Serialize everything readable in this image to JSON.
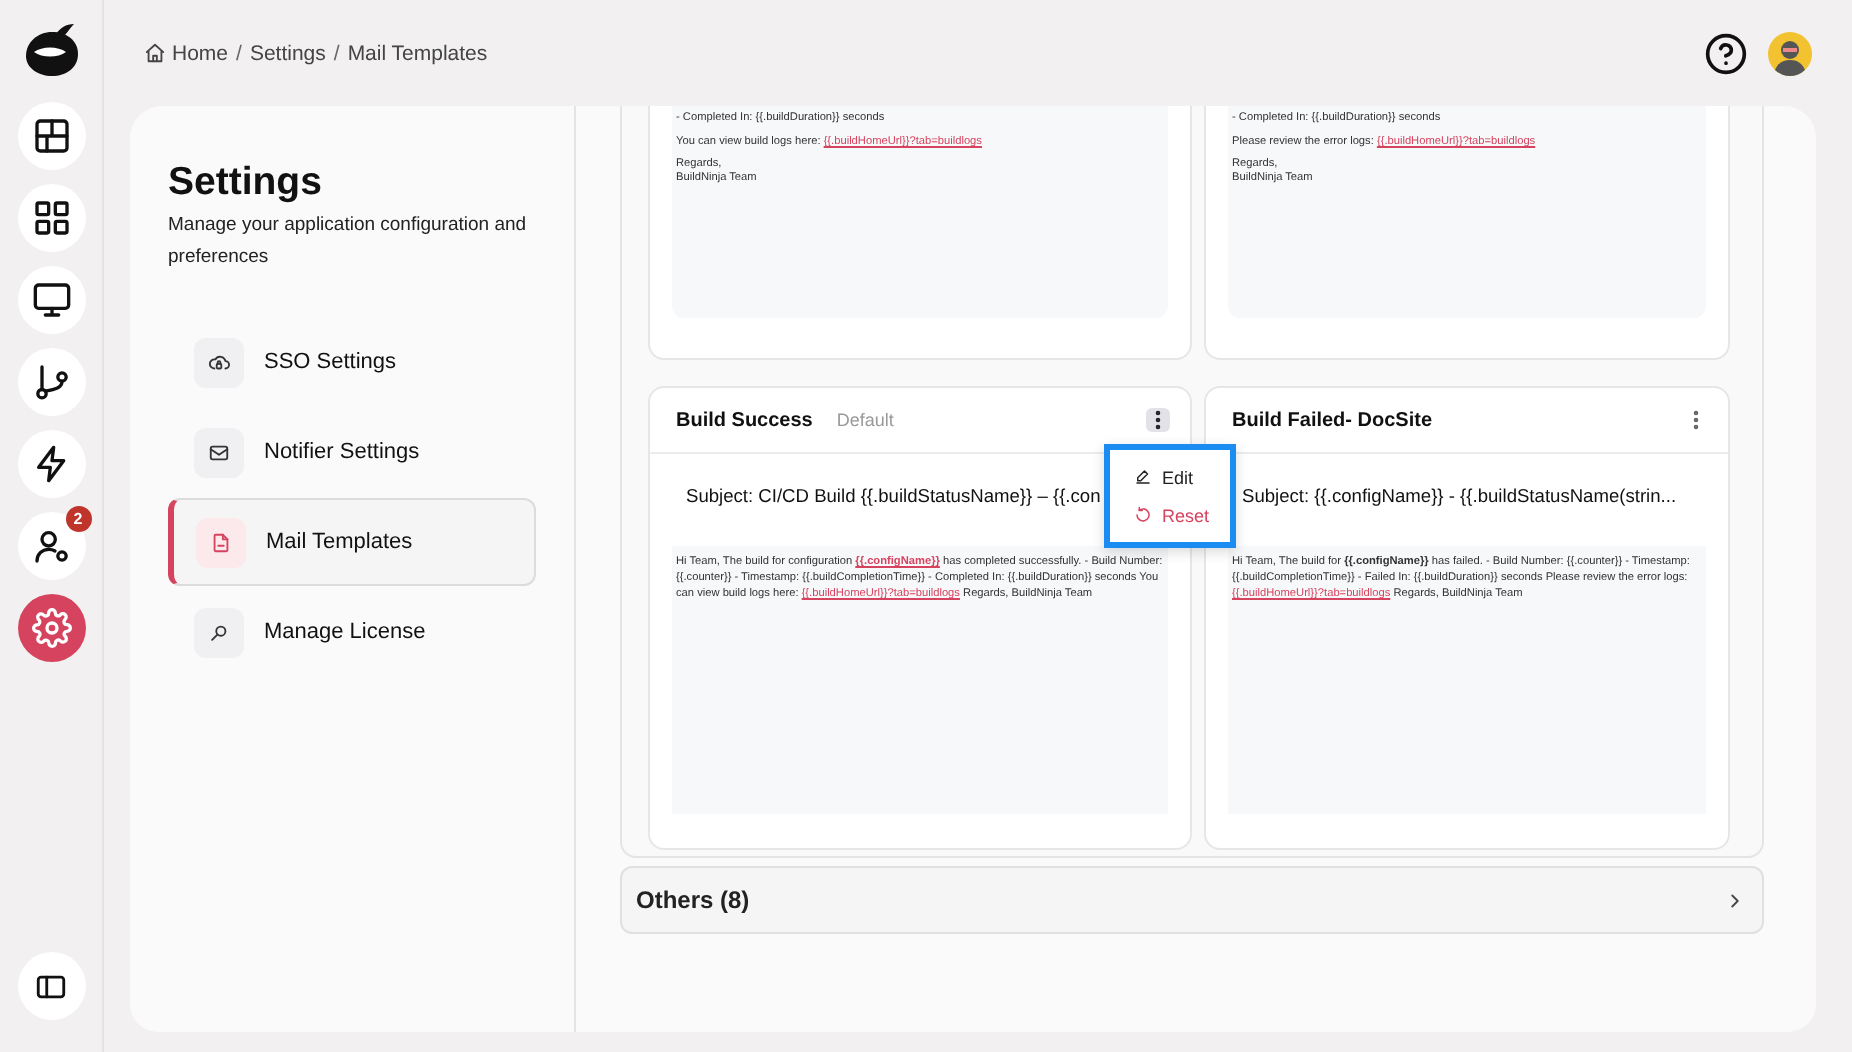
{
  "rail": {
    "items": [
      {
        "kind": "layout",
        "selected": false
      },
      {
        "kind": "grid",
        "selected": false
      },
      {
        "kind": "monitor",
        "selected": false
      },
      {
        "kind": "branch",
        "selected": false
      },
      {
        "kind": "bolt",
        "selected": false
      },
      {
        "kind": "user-gear",
        "selected": false,
        "badge": "2"
      },
      {
        "kind": "gear",
        "selected": true
      }
    ],
    "footer": {
      "kind": "panel"
    }
  },
  "breadcrumb": [
    "Home",
    "Settings",
    "Mail Templates"
  ],
  "breadcrumb_separator": "/",
  "settings": {
    "title": "Settings",
    "description": "Manage your application configuration and preferences",
    "items": [
      {
        "label": "SSO Settings",
        "kind": "cloud",
        "selected": false
      },
      {
        "label": "Notifier Settings",
        "kind": "mail",
        "selected": false
      },
      {
        "label": "Mail Templates",
        "kind": "file",
        "selected": true
      },
      {
        "label": "Manage License",
        "kind": "key",
        "selected": false
      }
    ]
  },
  "clipped_cards": [
    {
      "paragraphs": [
        [
          [
            {
              "kind": "text",
              "text": "- Completed In: {{.buildDuration}} seconds"
            }
          ]
        ],
        [
          [
            {
              "kind": "text",
              "text": "You can view build logs here: "
            },
            {
              "kind": "link",
              "text": "{{.buildHomeUrl}}?tab=buildlogs"
            }
          ]
        ],
        [
          [
            {
              "kind": "text",
              "text": "Regards,"
            }
          ],
          [
            {
              "kind": "text",
              "text": "BuildNinja Team"
            }
          ]
        ]
      ]
    },
    {
      "paragraphs": [
        [
          [
            {
              "kind": "text",
              "text": "- Completed In: {{.buildDuration}} seconds"
            }
          ]
        ],
        [
          [
            {
              "kind": "text",
              "text": "Please review the error logs: "
            },
            {
              "kind": "link",
              "text": "{{.buildHomeUrl}}?tab=buildlogs"
            }
          ]
        ],
        [
          [
            {
              "kind": "text",
              "text": "Regards,"
            }
          ],
          [
            {
              "kind": "text",
              "text": "BuildNinja Team"
            }
          ]
        ]
      ]
    }
  ],
  "templates": [
    {
      "title": "Build Success",
      "badge": "Default",
      "subject": "Subject: CI/CD Build {{.buildStatusName}} – {{.con",
      "body": [
        {
          "kind": "text",
          "text": "Hi Team, The build for configuration "
        },
        {
          "kind": "bold-link",
          "text": "{{.configName}}"
        },
        {
          "kind": "text",
          "text": " has completed successfully. - Build Number: {{.counter}} - Timestamp: {{.buildCompletionTime}} - Completed In: {{.buildDuration}} seconds You can view build logs here: "
        },
        {
          "kind": "link",
          "text": "{{.buildHomeUrl}}?tab=buildlogs"
        },
        {
          "kind": "text",
          "text": " Regards, BuildNinja Team"
        }
      ],
      "menu_open": true,
      "menu": [
        {
          "label": "Edit",
          "kind": "edit"
        },
        {
          "label": "Reset",
          "kind": "reset"
        }
      ]
    },
    {
      "title": "Build Failed- DocSite",
      "subject": "Subject: {{.configName}} - {{.buildStatusName(strin...",
      "body": [
        {
          "kind": "text",
          "text": "Hi Team, The build for "
        },
        {
          "kind": "bold",
          "text": "{{.configName}}"
        },
        {
          "kind": "text",
          "text": " has failed. - Build Number: {{.counter}} - Timestamp: {{.buildCompletionTime}} - Failed In: {{.buildDuration}} seconds Please review the error logs: "
        },
        {
          "kind": "link",
          "text": "{{.buildHomeUrl}}?tab=buildlogs"
        },
        {
          "kind": "text",
          "text": " Regards, BuildNinja Team"
        }
      ],
      "menu_open": false
    }
  ],
  "others": {
    "label": "Others (8)",
    "expanded": false
  }
}
